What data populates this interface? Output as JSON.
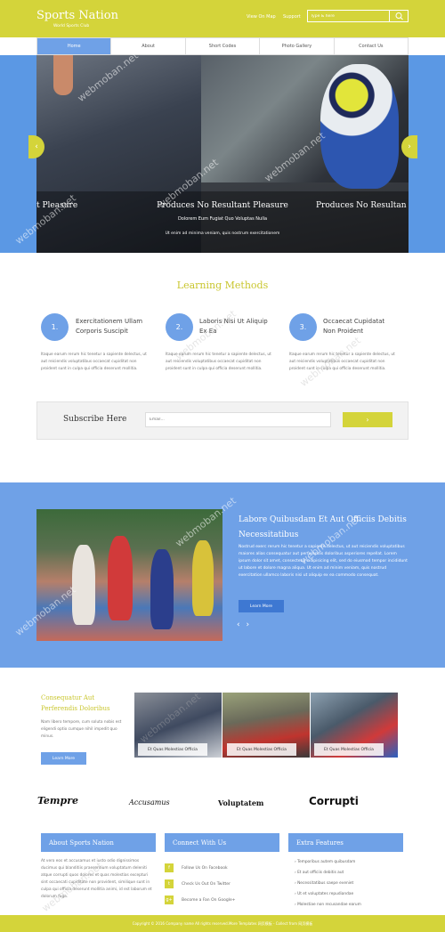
{
  "header": {
    "logo": "Sports Nation",
    "tagline": "World Sports Club",
    "links": [
      "View On Map",
      "Support"
    ],
    "search_placeholder": "Type & here"
  },
  "nav": [
    "Home",
    "About",
    "Short Codes",
    "Photo Gallery",
    "Contact Us"
  ],
  "hero": {
    "title_left": "t Pleasure",
    "title": "Produces No Resultant Pleasure",
    "title_right": "Produces No Resultan",
    "subtitle": "Dolorem Eum Fugiat Quo Voluptas Nulla",
    "description": "Ut enim ad minima veniam, quis nostrum exercitationem"
  },
  "methods": {
    "heading": "Learning Methods",
    "items": [
      {
        "num": "1.",
        "title": "Exercitationem Ullam Corporis Suscipit",
        "text": "Itaque earum rerum hic tenetur a sapiente delectus, ut aut reiciendis voluptatibus occaecat cupiditat non proident sunt in culpa qui officia deserunt mollitia."
      },
      {
        "num": "2.",
        "title": "Laboris Nisi Ut Aliquip Ex Ea",
        "text": "Itaque earum rerum hic tenetur a sapiente delectus, ut aut reiciendis voluptatibus occaecat cupiditat non proident sunt in culpa qui officia deserunt mollitia."
      },
      {
        "num": "3.",
        "title": "Occaecat Cupidatat Non Proident",
        "text": "Itaque earum rerum hic tenetur a sapiente delectus, ut aut reiciendis voluptatibus occaecat cupiditat non proident sunt in culpa qui officia deserunt mollitia."
      }
    ]
  },
  "subscribe": {
    "label": "Subscribe Here",
    "placeholder": "Email...",
    "button": "›"
  },
  "feature": {
    "title": "Labore Quibusdam Et Aut Officiis Debitis Necessitatibus",
    "text": "Nostrud exerc rerum hic tenetur a sapiente delectus, ut aut reiciendis voluptatibus maiores alias consequatur aut perferendis doloribus asperiores repellat. Lorem ipsum dolor sit amet, consectetur adipisicing elit, sed do eiusmod tempor incididunt ut labore et dolore magna aliqua. Ut enim ad minim veniam, quis nostrud exercitation ullamco laboris nisi ut aliquip ex ea commodo consequat.",
    "button": "Learn More",
    "arrows": "‹ ›"
  },
  "promo": {
    "title": "Consequatur Aut Perferendis Doloribus",
    "text": "Nam libero tempore, cum soluta nobis est eligendi optio cumque nihil impedit quo minus.",
    "button": "Learn More",
    "captions": [
      "Et Quas Molestias Officia",
      "Et Quas Molestias Officia",
      "Et Quas Molestias Officia"
    ]
  },
  "brands": [
    "Tempre",
    "Accusamus",
    "Voluptatem",
    "Corrupti"
  ],
  "footer_cols": {
    "about": {
      "heading": "About Sports Nation",
      "text": "At vero eos et accusamus et iusto odio dignissimos ducimus qui blanditiis praesentium voluptatum deleniti atque corrupti quos dolores et quas molestias excepturi sint occaecati cupiditate non provident, similique sunt in culpa qui officia deserunt mollitia animi, id est laborum et dolorum fuga."
    },
    "connect": {
      "heading": "Connect With Us",
      "items": [
        {
          "icon": "f",
          "label": "Follow Us On Facebook"
        },
        {
          "icon": "t",
          "label": "Check Us Out On Twitter"
        },
        {
          "icon": "g+",
          "label": "Become a Fan On Google+"
        }
      ]
    },
    "extra": {
      "heading": "Extra Features",
      "items": [
        "Temporibus autem quibusdam",
        "Et aut officiis debitis aut",
        "Necessitatibus saepe eveniet",
        "Ut et voluptates repudiandae",
        "Molestiae non recusandae earum"
      ]
    }
  },
  "footer": {
    "copyright": "Copyright © 2016 Company name All rights reserved.More Templates 网页模板 - Collect from 网页模板"
  },
  "watermark": "webmoban.net",
  "colors": {
    "accent": "#d4d43a",
    "blue": "#6fa1e7",
    "dark_blue": "#3e78d2"
  }
}
